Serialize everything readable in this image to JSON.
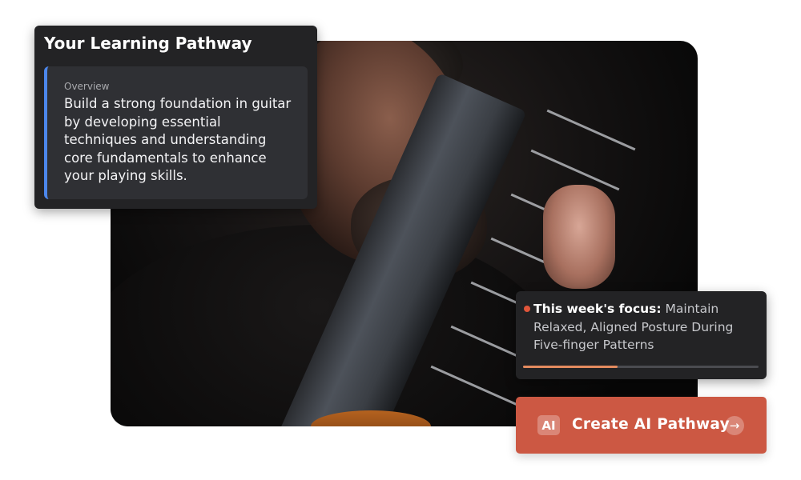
{
  "pathway_card": {
    "title": "Your Learning Pathway",
    "overview_label": "Overview",
    "overview_text": "Build a strong foundation in guitar by developing essential techniques and understanding core fundamentals to enhance your playing skills."
  },
  "focus_card": {
    "prefix": "This week's focus:",
    "text": " Maintain Relaxed, Aligned Posture During Five-finger Patterns",
    "progress_percent": 40,
    "dot_color": "#e0553a"
  },
  "cta": {
    "badge": "AI",
    "label": "Create AI Pathway",
    "icon": "arrow-right-icon",
    "arrow_glyph": "→",
    "color": "#cc5843"
  },
  "accent_color": "#4c87ec"
}
